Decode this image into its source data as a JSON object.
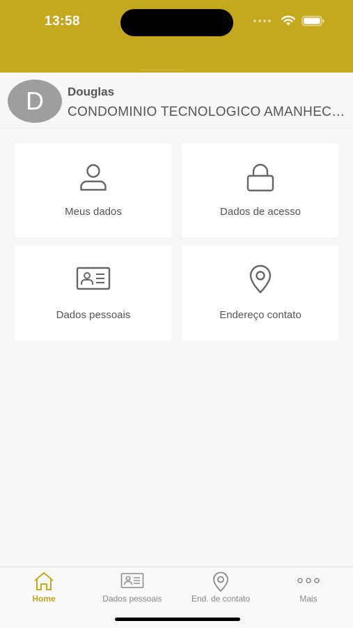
{
  "status_bar": {
    "time": "13:58",
    "icons": [
      "signal-dots-icon",
      "wifi-icon",
      "battery-icon"
    ]
  },
  "colors": {
    "brand": "#c4a81e",
    "background": "#f7f7f7",
    "card": "#ffffff",
    "text": "#555555",
    "avatar": "#9e9e9e"
  },
  "profile": {
    "initial": "D",
    "name": "Douglas",
    "condominium": "CONDOMINIO TECNOLOGICO AMANHECER"
  },
  "menu": [
    {
      "label": "Meus dados",
      "icon": "user-icon"
    },
    {
      "label": "Dados de acesso",
      "icon": "lock-icon"
    },
    {
      "label": "Dados pessoais",
      "icon": "id-card-icon"
    },
    {
      "label": "Endereço contato",
      "icon": "location-pin-icon"
    }
  ],
  "tabs": [
    {
      "label": "Home",
      "icon": "home-icon",
      "active": true
    },
    {
      "label": "Dados pessoais",
      "icon": "id-card-icon",
      "active": false
    },
    {
      "label": "End. de contato",
      "icon": "location-pin-icon",
      "active": false
    },
    {
      "label": "Mais",
      "icon": "more-icon",
      "active": false
    }
  ]
}
